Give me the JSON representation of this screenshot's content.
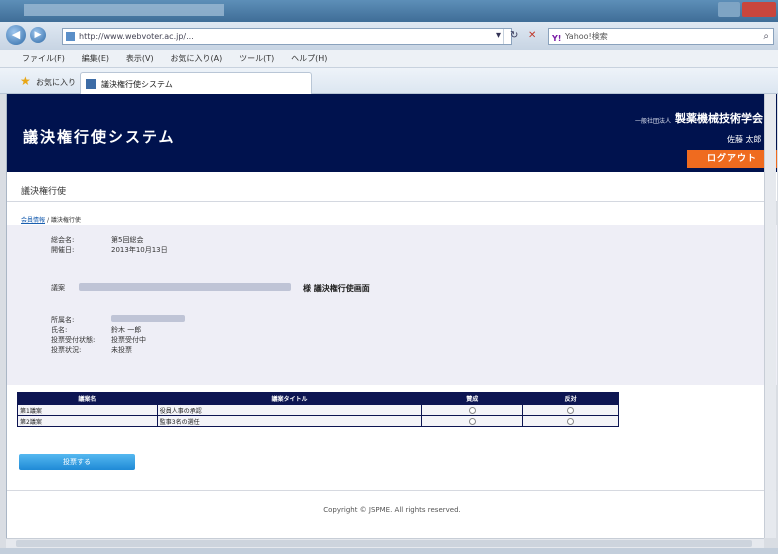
{
  "browser": {
    "url": "http://www.webvoter.ac.jp/...",
    "search_placeholder": "Yahoo!検索",
    "menu": [
      "ファイル(F)",
      "編集(E)",
      "表示(V)",
      "お気に入り(A)",
      "ツール(T)",
      "ヘルプ(H)"
    ],
    "favorites_label": "お気に入り",
    "tab_title": "議決権行使システム"
  },
  "header": {
    "system_title": "議決権行使システム",
    "org_prefix": "一般社団法人",
    "org_name": "製薬機械技術学会",
    "user_name": "佐藤 太郎 様",
    "logout_label": "ログアウト"
  },
  "section_title": "議決権行使",
  "breadcrumb": {
    "home": "会員情報",
    "current": "議決権行使"
  },
  "meeting": {
    "name_label": "総会名:",
    "name_value": "第5回総会",
    "date_label": "開催日:",
    "date_value": "2013年10月13日",
    "proposal_label": "議案",
    "proposal_title": "様 議決権行使画面"
  },
  "member": {
    "labels": [
      "所属名:",
      "氏名:",
      "投票受付状態:",
      "投票状況:"
    ],
    "values": [
      "",
      "鈴木 一郎",
      "投票受付中",
      "未投票"
    ]
  },
  "votes_table": {
    "headers": [
      "議案名",
      "議案タイトル",
      "賛成",
      "反対"
    ],
    "rows": [
      {
        "name": "第1議案",
        "title": "役員人事の承認"
      },
      {
        "name": "第2議案",
        "title": "監事3名の選任"
      }
    ]
  },
  "confirm_label": "投票する",
  "footer": {
    "copyright": "Copyright © JSPME. All rights reserved."
  },
  "colors": {
    "header_bg": "#00124e",
    "accent": "#ef6b1f",
    "button": "#1f8ad6"
  }
}
